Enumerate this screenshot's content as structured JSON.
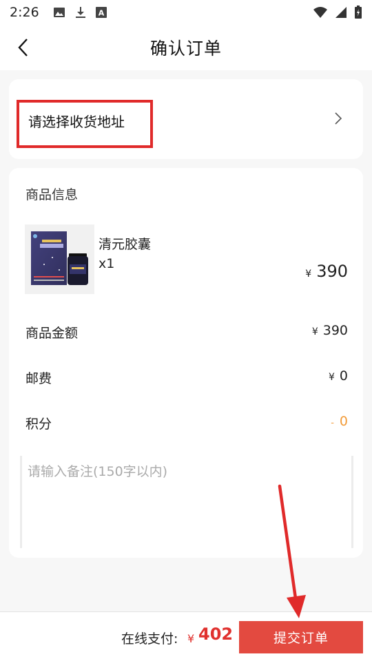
{
  "status_bar": {
    "time": "2:26",
    "icons": [
      "image-icon",
      "download-icon",
      "font-icon",
      "wifi-icon",
      "signal-icon",
      "battery-icon"
    ]
  },
  "header": {
    "title": "确认订单",
    "back_icon": "chevron-left-icon"
  },
  "address": {
    "prompt": "请选择收货地址",
    "highlight_color": "#e02a2a"
  },
  "goods": {
    "section_title": "商品信息",
    "product": {
      "name": "清元胶囊",
      "quantity": "x1",
      "currency": "¥",
      "price": "390"
    },
    "summary": [
      {
        "label": "商品金额",
        "prefix": "¥",
        "value": "390"
      },
      {
        "label": "邮费",
        "prefix": "¥",
        "value": "0"
      },
      {
        "label": "积分",
        "prefix": "-",
        "value": "0"
      }
    ],
    "remark": {
      "placeholder": "请输入备注(150字以内)",
      "value": ""
    }
  },
  "footer": {
    "pay_label": "在线支付:",
    "currency": "¥",
    "total": "402",
    "submit_label": "提交订单",
    "accent_color": "#e34a40",
    "price_color": "#e0312e"
  },
  "colors": {
    "background": "#f7f7f7",
    "card": "#ffffff",
    "points": "#f29b38",
    "annotation_arrow": "#e02a2a"
  }
}
